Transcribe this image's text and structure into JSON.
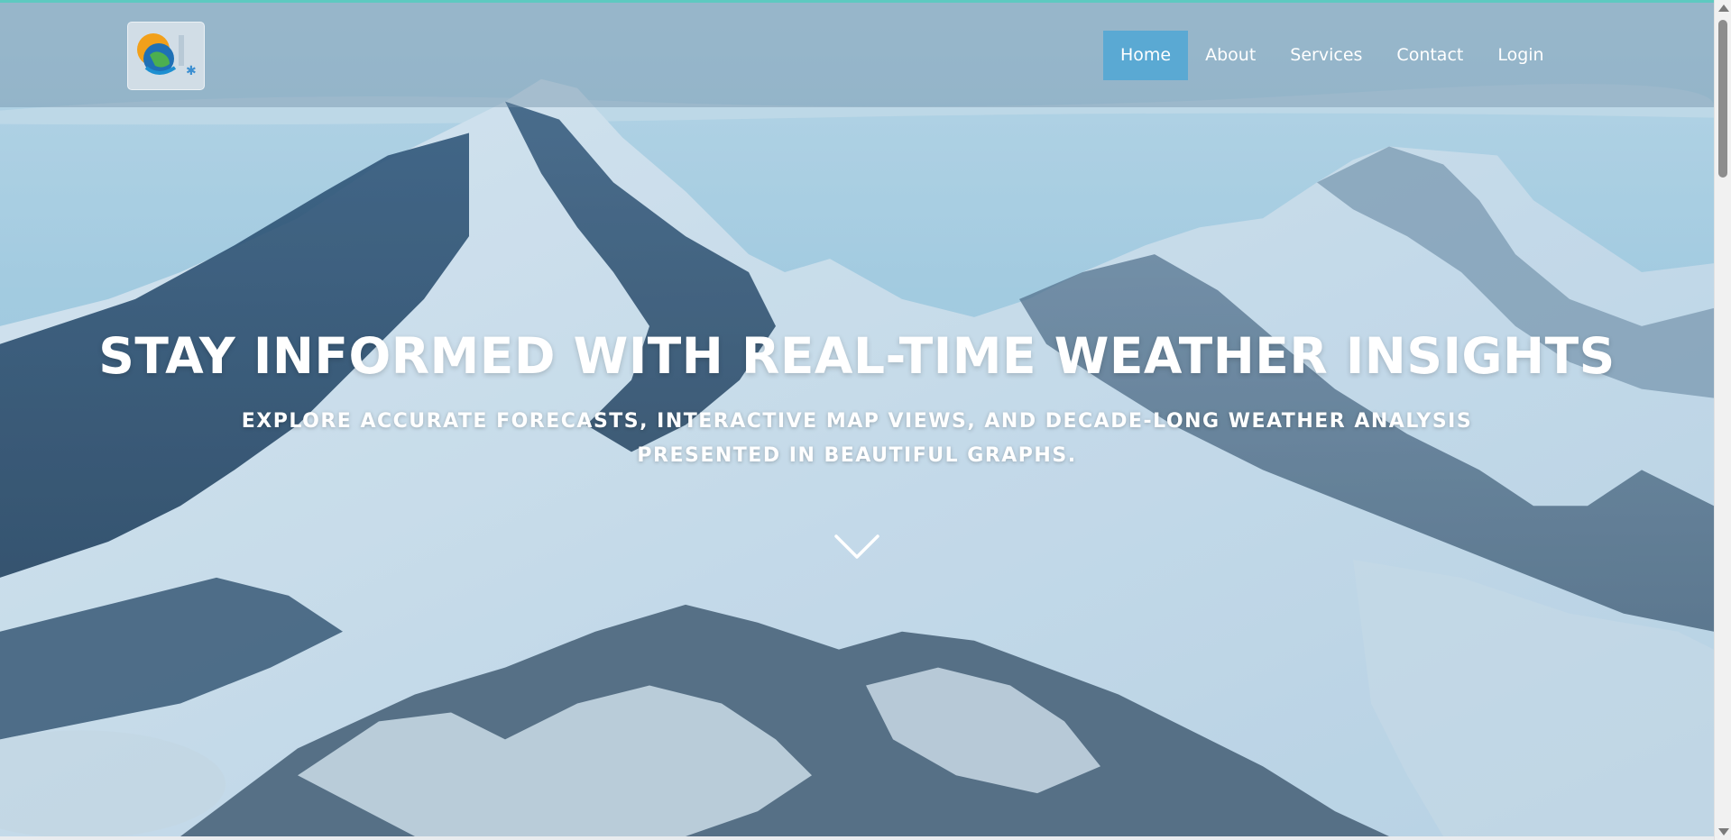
{
  "nav": {
    "items": [
      {
        "label": "Home",
        "active": true
      },
      {
        "label": "About",
        "active": false
      },
      {
        "label": "Services",
        "active": false
      },
      {
        "label": "Contact",
        "active": false
      },
      {
        "label": "Login",
        "active": false
      }
    ]
  },
  "hero": {
    "headline": "STAY INFORMED WITH REAL-TIME WEATHER INSIGHTS",
    "subtext": "EXPLORE ACCURATE FORECASTS, INTERACTIVE MAP VIEWS, AND DECADE-LONG WEATHER ANALYSIS PRESENTED IN BEAUTIFUL GRAPHS.",
    "scroll_icon": "chevron-down-icon"
  },
  "colors": {
    "nav_active": "#5aa9d3",
    "sky": "#b7dbea",
    "accent_top": "#5ec9c0"
  }
}
